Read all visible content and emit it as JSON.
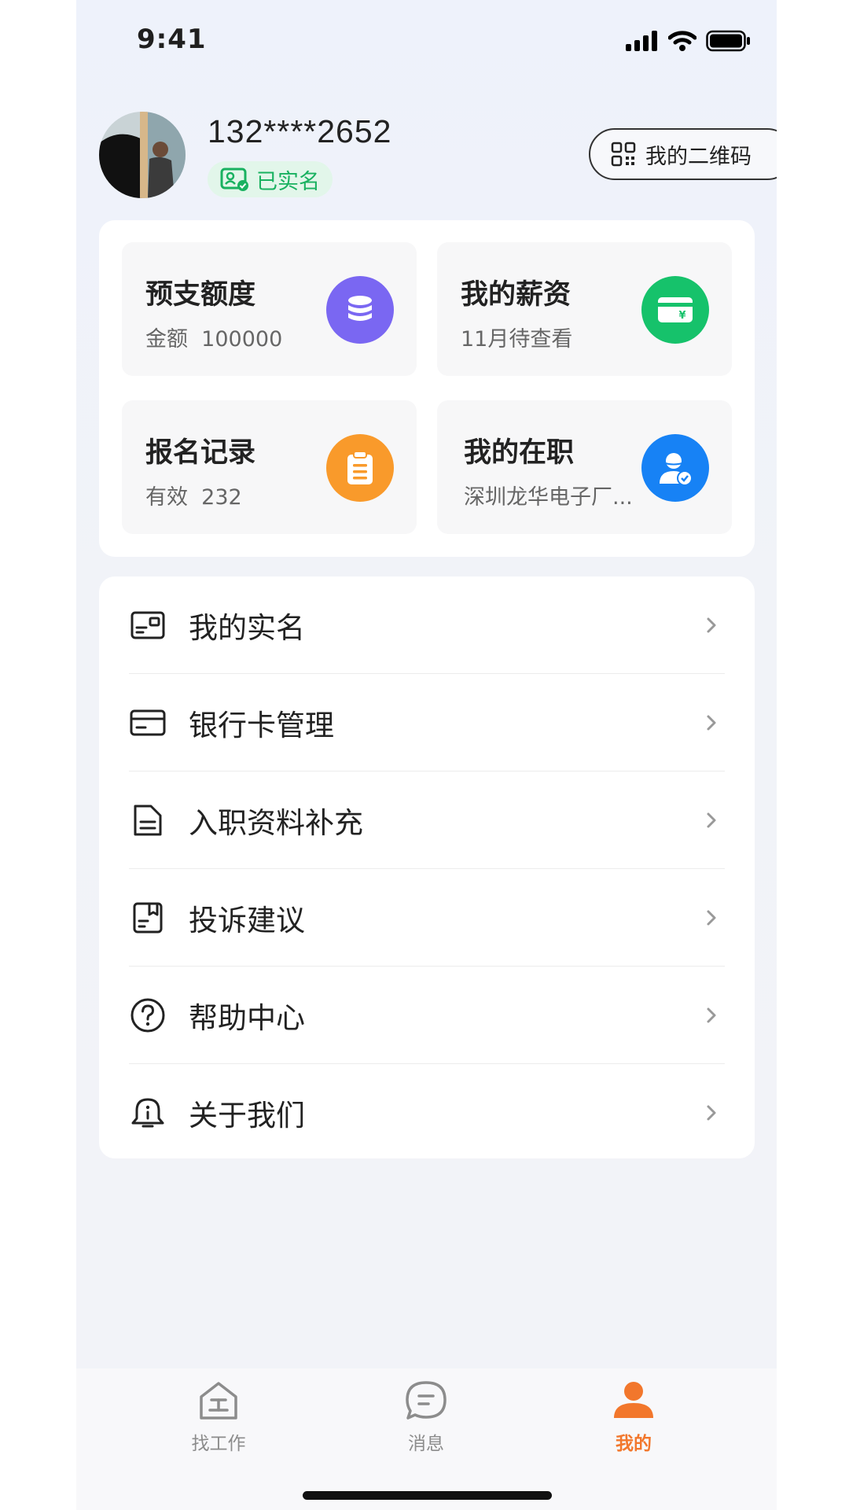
{
  "status_bar": {
    "time": "9:41"
  },
  "profile": {
    "phone": "132****2652",
    "verified_label": "已实名",
    "qr_button_label": "我的二维码"
  },
  "tiles": [
    {
      "title": "预支额度",
      "subtitle_prefix": "金额",
      "subtitle_value": "100000",
      "icon": "coins-stack-icon",
      "color": "#7a67f2"
    },
    {
      "title": "我的薪资",
      "subtitle_prefix": "11月待查看",
      "subtitle_value": "",
      "icon": "yuan-card-icon",
      "color": "#16c26b"
    },
    {
      "title": "报名记录",
      "subtitle_prefix": "有效",
      "subtitle_value": "232",
      "icon": "clipboard-icon",
      "color": "#f99a2b"
    },
    {
      "title": "我的在职",
      "subtitle_prefix": "深圳龙华电子厂...",
      "subtitle_value": "",
      "icon": "user-verified-icon",
      "color": "#1782f5"
    }
  ],
  "menu": [
    {
      "label": "我的实名",
      "icon": "id-card-icon"
    },
    {
      "label": "银行卡管理",
      "icon": "bank-card-icon"
    },
    {
      "label": "入职资料补充",
      "icon": "document-icon"
    },
    {
      "label": "投诉建议",
      "icon": "complaint-icon"
    },
    {
      "label": "帮助中心",
      "icon": "help-icon"
    },
    {
      "label": "关于我们",
      "icon": "about-icon"
    }
  ],
  "tabbar": [
    {
      "label": "找工作",
      "icon": "home-work-icon",
      "active": false
    },
    {
      "label": "消息",
      "icon": "message-icon",
      "active": false
    },
    {
      "label": "我的",
      "icon": "person-icon",
      "active": true
    }
  ],
  "colors": {
    "accent": "#f2772c",
    "verified_green": "#19b160"
  }
}
